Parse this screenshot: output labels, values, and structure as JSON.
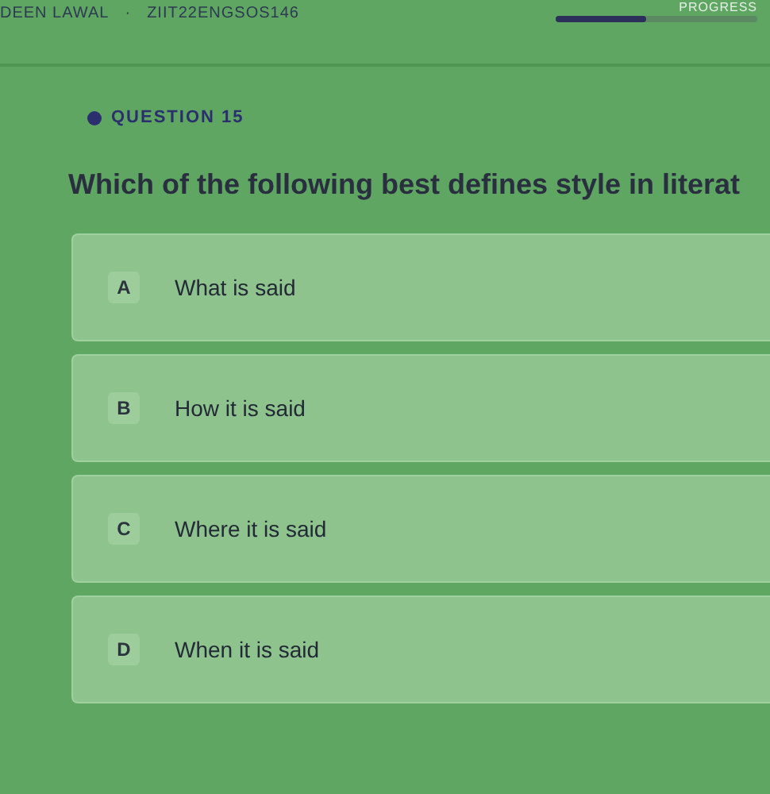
{
  "header": {
    "student": "DEEN LAWAL",
    "separator": "·",
    "code": "ZIIT22ENGSOS146",
    "progress_label": "PROGRESS",
    "progress": {
      "level": 0.45
    }
  },
  "question": {
    "label": "QUESTION 15",
    "text": "Which of the following best defines style in literat"
  },
  "options": [
    {
      "letter": "A",
      "text": "What is said"
    },
    {
      "letter": "B",
      "text": "How it is said"
    },
    {
      "letter": "C",
      "text": "Where it is said"
    },
    {
      "letter": "D",
      "text": "When it is said"
    }
  ]
}
